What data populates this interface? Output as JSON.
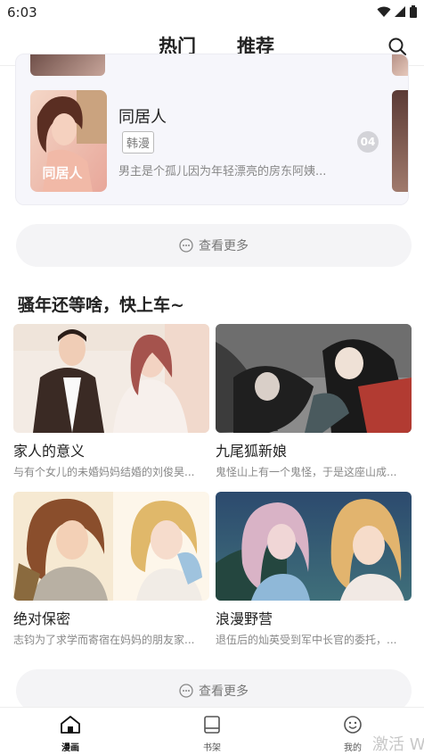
{
  "status": {
    "time": "6:03"
  },
  "header": {
    "tabs": [
      {
        "label": "热门"
      },
      {
        "label": "推荐"
      }
    ]
  },
  "hot": {
    "title": "同居人",
    "tag": "韩漫",
    "rank": "04",
    "desc": "男主是个孤儿因为年轻漂亮的房东阿姨...",
    "cover_text": "同居人"
  },
  "more_label": "查看更多",
  "section": {
    "title": "骚年还等啥，快上车~"
  },
  "grid": [
    {
      "title": "家人的意义",
      "desc": "与有个女儿的未婚妈妈结婚的刘俊昊..."
    },
    {
      "title": "九尾狐新娘",
      "desc": "鬼怪山上有一个鬼怪，于是这座山成..."
    },
    {
      "title": "绝对保密",
      "desc": "志钧为了求学而寄宿在妈妈的朋友家..."
    },
    {
      "title": "浪漫野营",
      "desc": "退伍后的灿英受到军中长官的委托，..."
    }
  ],
  "nav": [
    {
      "label": "漫画"
    },
    {
      "label": "书架"
    },
    {
      "label": "我的"
    }
  ],
  "watermark": "激活 W",
  "colors": {
    "accent": "#111111",
    "badge": "#d3d3d8",
    "muted": "#888888"
  }
}
